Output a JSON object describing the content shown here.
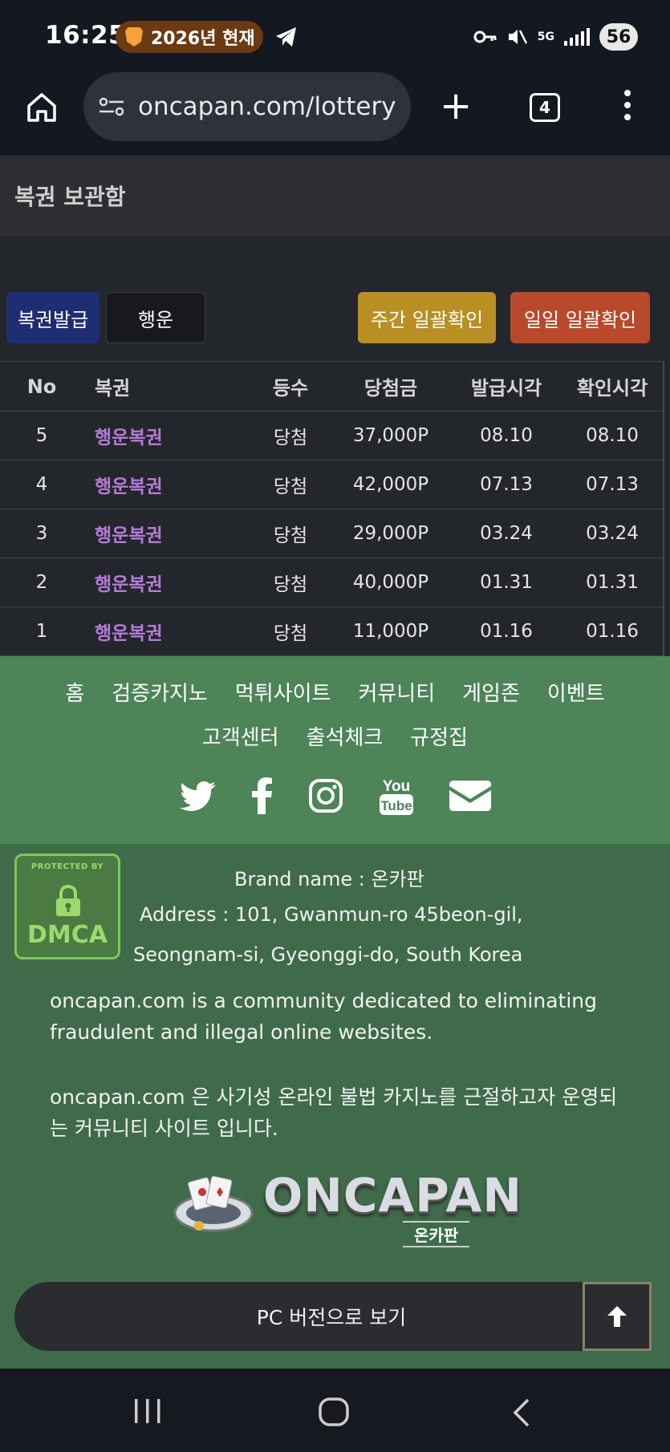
{
  "status_bar": {
    "time": "16:25",
    "notification_pill": "2026년 현재",
    "network": "5G",
    "battery": "56",
    "icons": [
      "brave-icon",
      "telegram-icon",
      "key-icon",
      "mute-icon",
      "signal-icon",
      "battery-icon"
    ]
  },
  "browser": {
    "url": "oncapan.com/lottery",
    "tab_count": "4"
  },
  "page": {
    "title": "복권 보관함",
    "buttons": {
      "issue": "복권발급",
      "luck": "행운",
      "weekly": "주간 일괄확인",
      "daily": "일일 일괄확인"
    },
    "colors": {
      "issue": "#1e2e73",
      "weekly": "#b98f24",
      "daily": "#b9492a",
      "lottery_name": "#b57ad6",
      "footer_nav": "#4d8458",
      "footer_info": "#3f6b4a"
    },
    "table": {
      "headers": [
        "No",
        "복권",
        "등수",
        "당첨금",
        "발급시각",
        "확인시각"
      ],
      "rows": [
        {
          "no": "5",
          "name": "행운복권",
          "rank": "당첨",
          "prize": "37,000P",
          "issued": "08.10",
          "checked": "08.10"
        },
        {
          "no": "4",
          "name": "행운복권",
          "rank": "당첨",
          "prize": "42,000P",
          "issued": "07.13",
          "checked": "07.13"
        },
        {
          "no": "3",
          "name": "행운복권",
          "rank": "당첨",
          "prize": "29,000P",
          "issued": "03.24",
          "checked": "03.24"
        },
        {
          "no": "2",
          "name": "행운복권",
          "rank": "당첨",
          "prize": "40,000P",
          "issued": "01.31",
          "checked": "01.31"
        },
        {
          "no": "1",
          "name": "행운복권",
          "rank": "당첨",
          "prize": "11,000P",
          "issued": "01.16",
          "checked": "01.16"
        }
      ]
    }
  },
  "footer": {
    "nav_row1": [
      "홈",
      "검증카지노",
      "먹튀사이트",
      "커뮤니티",
      "게임존",
      "이벤트"
    ],
    "nav_row2": [
      "고객센터",
      "출석체크",
      "규정집"
    ],
    "social": [
      "twitter-icon",
      "facebook-icon",
      "instagram-icon",
      "youtube-icon",
      "email-icon"
    ],
    "youtube_you": "You",
    "youtube_tube": "Tube",
    "dmca_top": "PROTECTED BY",
    "dmca_text": "DMCA",
    "brand_line": "Brand name : 온카판",
    "address_line1": "Address : 101, Gwanmun-ro 45beon-gil,",
    "address_line2": "Seongnam-si, Gyeonggi-do, South Korea",
    "desc_en": "oncapan.com is a community dedicated to eliminating fraudulent and illegal online websites.",
    "desc_ko": "oncapan.com 은 사기성 온라인 불법 카지노를 근절하고자 운영되는 커뮤니티 사이트 입니다.",
    "logo_word": "ONCAPAN",
    "logo_sub": "온카판",
    "pc_version": "PC 버전으로 보기"
  }
}
